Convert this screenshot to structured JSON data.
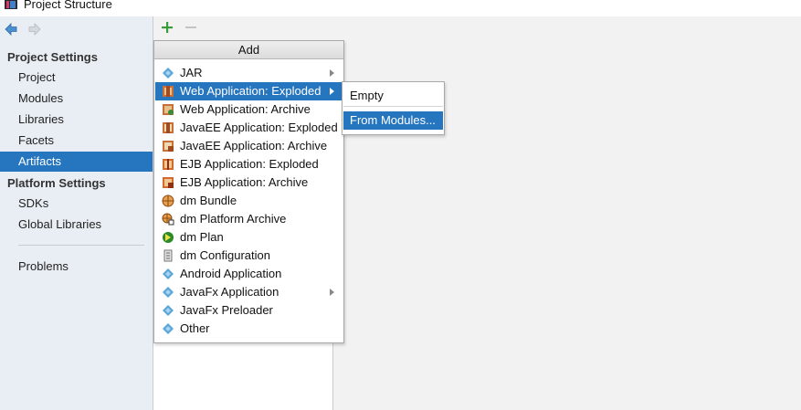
{
  "window": {
    "title": "Project Structure"
  },
  "sidebar": {
    "sections": [
      {
        "header": "Project Settings",
        "items": [
          {
            "label": "Project",
            "selected": false
          },
          {
            "label": "Modules",
            "selected": false
          },
          {
            "label": "Libraries",
            "selected": false
          },
          {
            "label": "Facets",
            "selected": false
          },
          {
            "label": "Artifacts",
            "selected": true
          }
        ]
      },
      {
        "header": "Platform Settings",
        "items": [
          {
            "label": "SDKs",
            "selected": false
          },
          {
            "label": "Global Libraries",
            "selected": false
          }
        ]
      }
    ],
    "extra_items": [
      {
        "label": "Problems"
      }
    ]
  },
  "toolbar": {
    "add_icon": "plus-icon",
    "remove_icon": "minus-icon"
  },
  "popup": {
    "title": "Add",
    "items": [
      {
        "label": "JAR",
        "icon": "jar-icon",
        "submenu": true
      },
      {
        "label": "Web Application: Exploded",
        "icon": "web-app-icon",
        "submenu": true,
        "highlighted": true
      },
      {
        "label": "Web Application: Archive",
        "icon": "web-archive-icon",
        "submenu": false
      },
      {
        "label": "JavaEE Application: Exploded",
        "icon": "javaee-app-icon",
        "submenu": false
      },
      {
        "label": "JavaEE Application: Archive",
        "icon": "javaee-archive-icon",
        "submenu": false
      },
      {
        "label": "EJB Application: Exploded",
        "icon": "ejb-app-icon",
        "submenu": false
      },
      {
        "label": "EJB Application: Archive",
        "icon": "ejb-archive-icon",
        "submenu": false
      },
      {
        "label": "dm Bundle",
        "icon": "dm-bundle-icon",
        "submenu": false
      },
      {
        "label": "dm Platform Archive",
        "icon": "dm-platform-icon",
        "submenu": false
      },
      {
        "label": "dm Plan",
        "icon": "dm-plan-icon",
        "submenu": false
      },
      {
        "label": "dm Configuration",
        "icon": "dm-config-icon",
        "submenu": false
      },
      {
        "label": "Android Application",
        "icon": "android-icon",
        "submenu": false
      },
      {
        "label": "JavaFx Application",
        "icon": "javafx-icon",
        "submenu": true
      },
      {
        "label": "JavaFx Preloader",
        "icon": "javafx-preloader-icon",
        "submenu": false
      },
      {
        "label": "Other",
        "icon": "other-icon",
        "submenu": false
      }
    ]
  },
  "submenu": {
    "items": [
      {
        "label": "Empty",
        "highlighted": false
      },
      {
        "label": "From Modules...",
        "highlighted": true
      }
    ]
  },
  "colors": {
    "selection": "#2675bf",
    "sidebar_bg": "#e9eef4",
    "window_bg": "#f2f2f2",
    "add_green": "#3a9b3a"
  }
}
